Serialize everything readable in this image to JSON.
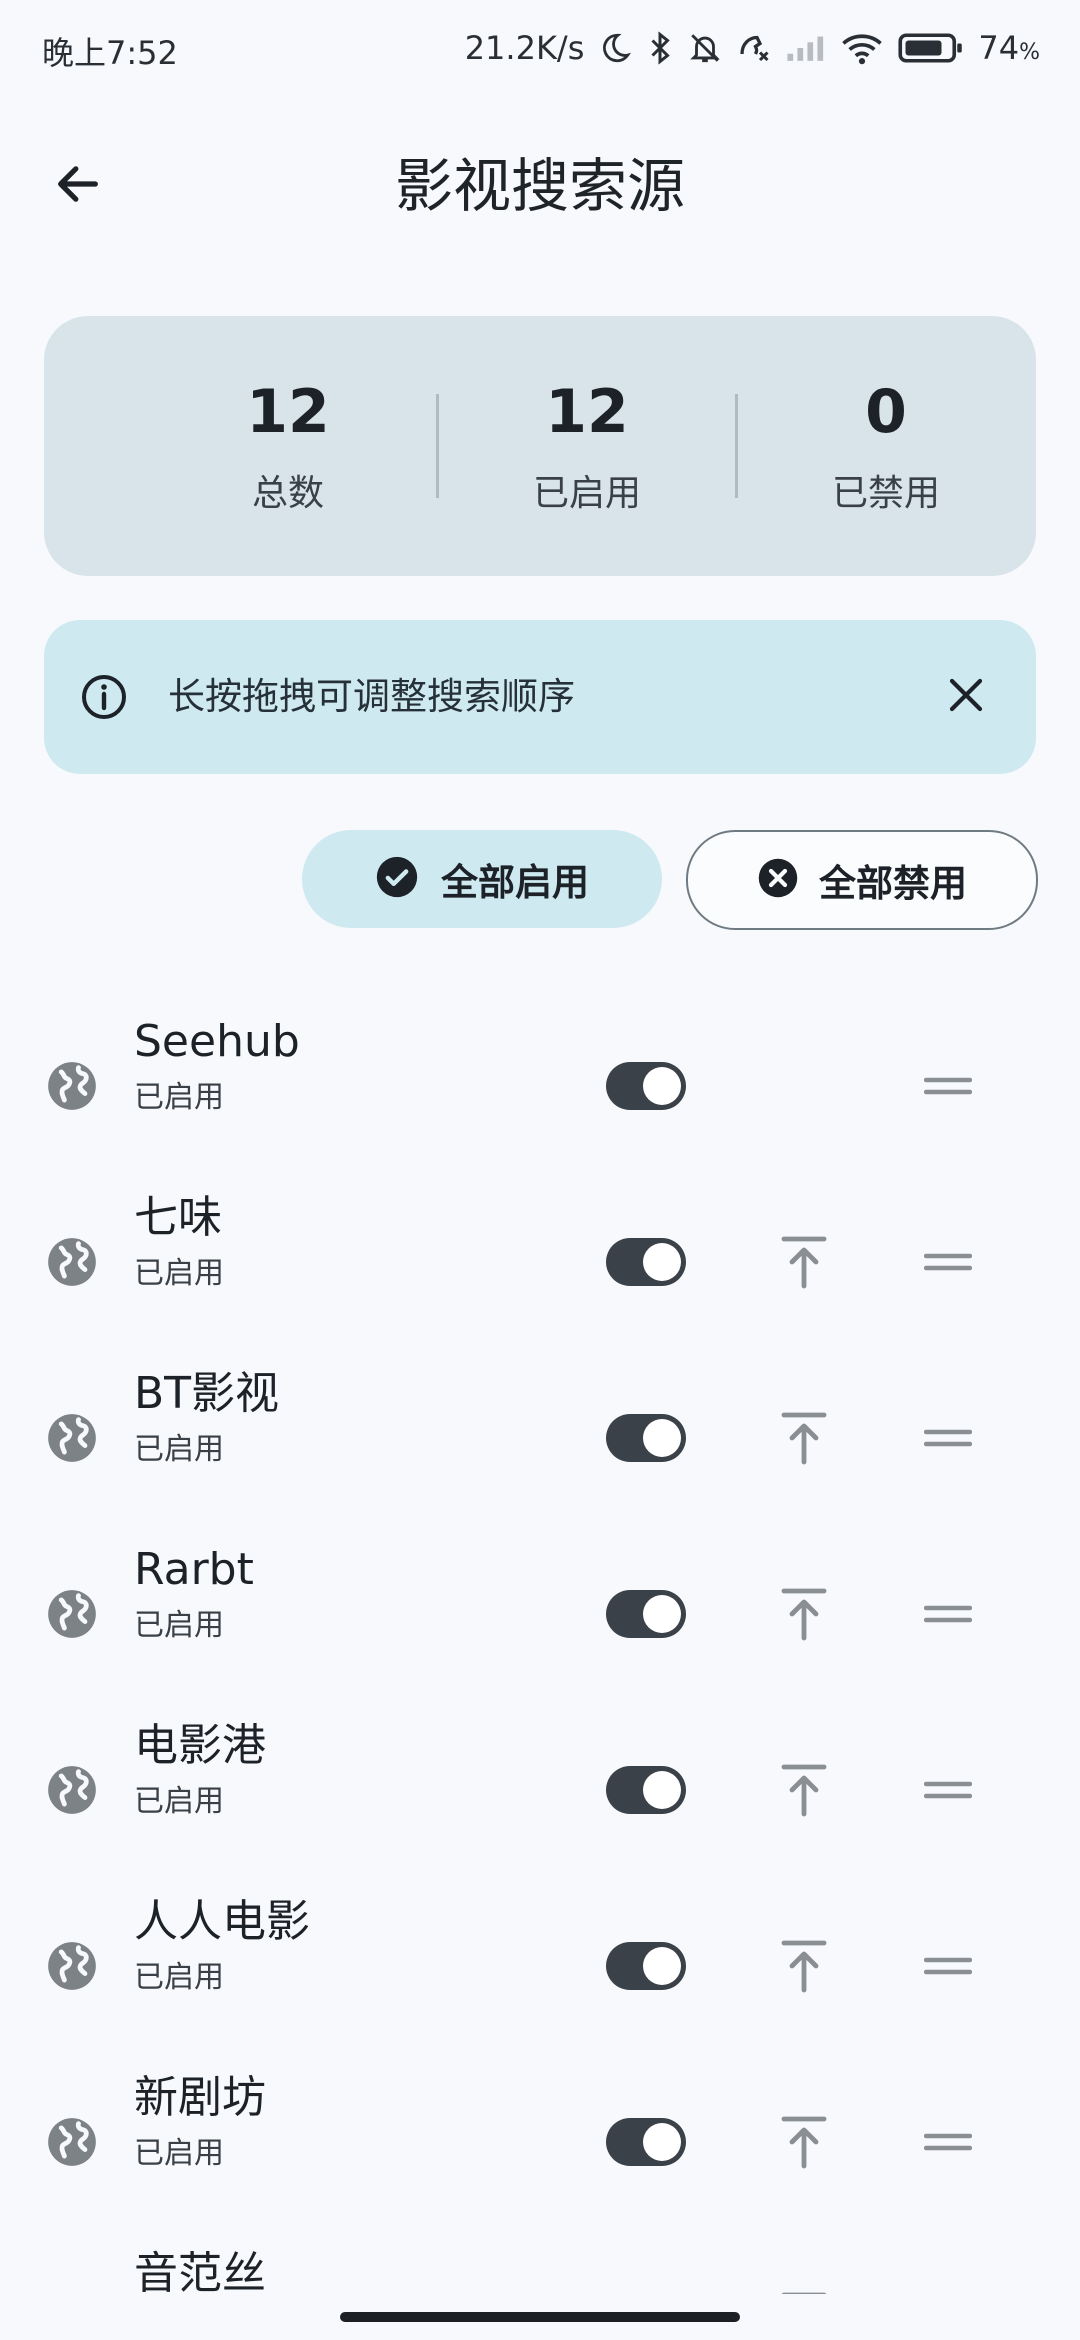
{
  "status_bar": {
    "time": "晚上7:52",
    "network_speed": "21.2K/s",
    "battery": "74",
    "battery_unit": "%",
    "icons": [
      "moon-icon",
      "bluetooth-icon",
      "bell-off-icon",
      "missed-call-icon",
      "cellular-signal-icon",
      "wifi-icon",
      "battery-icon"
    ]
  },
  "header": {
    "title": "影视搜索源",
    "back_icon": "arrow-left-icon"
  },
  "stats": [
    {
      "value": "12",
      "label": "总数"
    },
    {
      "value": "12",
      "label": "已启用"
    },
    {
      "value": "0",
      "label": "已禁用"
    }
  ],
  "hint": {
    "icon": "info-icon",
    "text": "长按拖拽可调整搜索顺序",
    "close_icon": "close-icon"
  },
  "actions": {
    "enable_all": "全部启用",
    "disable_all": "全部禁用"
  },
  "sources": [
    {
      "name": "Seehub",
      "status": "已启用",
      "enabled": true,
      "show_to_top": false
    },
    {
      "name": "七味",
      "status": "已启用",
      "enabled": true,
      "show_to_top": true
    },
    {
      "name": "BT影视",
      "status": "已启用",
      "enabled": true,
      "show_to_top": true
    },
    {
      "name": "Rarbt",
      "status": "已启用",
      "enabled": true,
      "show_to_top": true
    },
    {
      "name": "电影港",
      "status": "已启用",
      "enabled": true,
      "show_to_top": true
    },
    {
      "name": "人人电影",
      "status": "已启用",
      "enabled": true,
      "show_to_top": true
    },
    {
      "name": "新剧坊",
      "status": "已启用",
      "enabled": true,
      "show_to_top": true
    },
    {
      "name": "音范丝",
      "status": "",
      "enabled": true,
      "show_to_top": true
    }
  ],
  "colors": {
    "background": "#f7f9fc",
    "stats_card": "#d8e4ea",
    "hint_banner": "#cfe9f1",
    "toggle_on": "#3b4149",
    "icon_gray": "#7d8287"
  }
}
